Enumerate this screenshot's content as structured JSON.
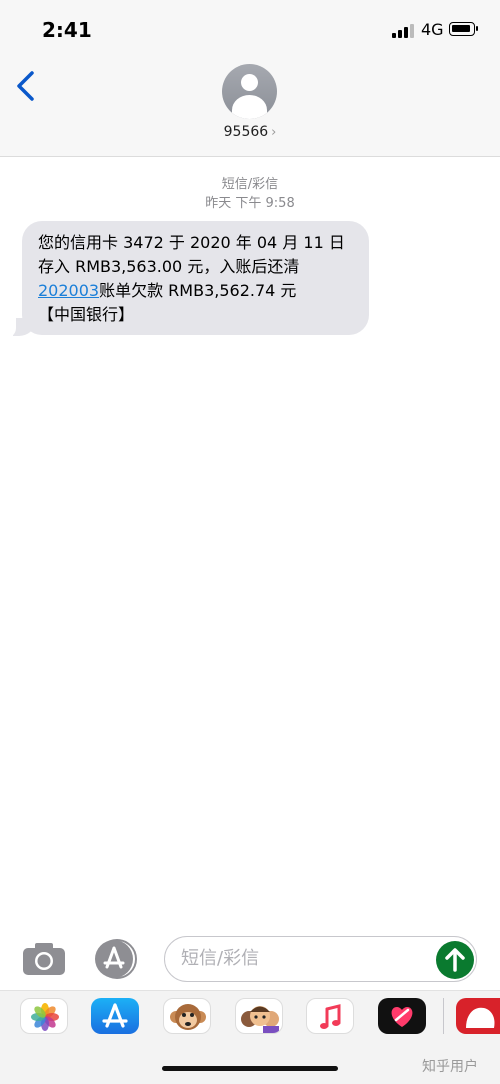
{
  "status_bar": {
    "time": "2:41",
    "network": "4G"
  },
  "header": {
    "contact": "95566",
    "chevron": "›",
    "back_icon": "chevron-left-icon"
  },
  "thread": {
    "message_type": "短信/彩信",
    "timestamp": "昨天 下午 9:58",
    "message": {
      "line1": "您的信用卡 3472 于 2020 年 04 月 11 日",
      "line2": "存入 RMB3,563.00 元，入账后还清",
      "line3_link": "202003",
      "line3_rest": "账单欠款 RMB3,562.74 元",
      "line4": "【中国银行】"
    }
  },
  "composer": {
    "placeholder": "短信/彩信"
  },
  "app_strip": {
    "apps": [
      "photos-icon",
      "appstore-icon",
      "animoji-icon",
      "memoji-icon",
      "music-icon",
      "digital-touch-icon",
      "partial-app-icon"
    ]
  },
  "watermark": "知乎用户",
  "colors": {
    "bubble": "#e5e5ea",
    "link": "#1b7fd8",
    "send": "#0a7a2f",
    "nav_blue": "#0a58ca"
  }
}
